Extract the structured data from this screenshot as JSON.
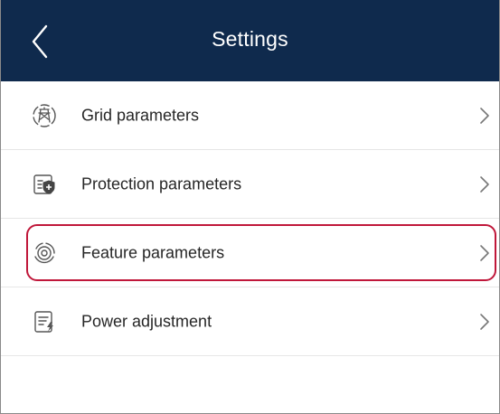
{
  "header": {
    "title": "Settings",
    "back_icon": "chevron-left-icon",
    "background": "#0f2a4d"
  },
  "menu": {
    "items": [
      {
        "label": "Grid parameters",
        "icon": "grid-tower-icon"
      },
      {
        "label": "Protection parameters",
        "icon": "shield-document-icon"
      },
      {
        "label": "Feature parameters",
        "icon": "feature-ring-icon",
        "highlighted": true
      },
      {
        "label": "Power adjustment",
        "icon": "power-adjust-icon"
      }
    ],
    "highlight_color": "#c0173a"
  }
}
